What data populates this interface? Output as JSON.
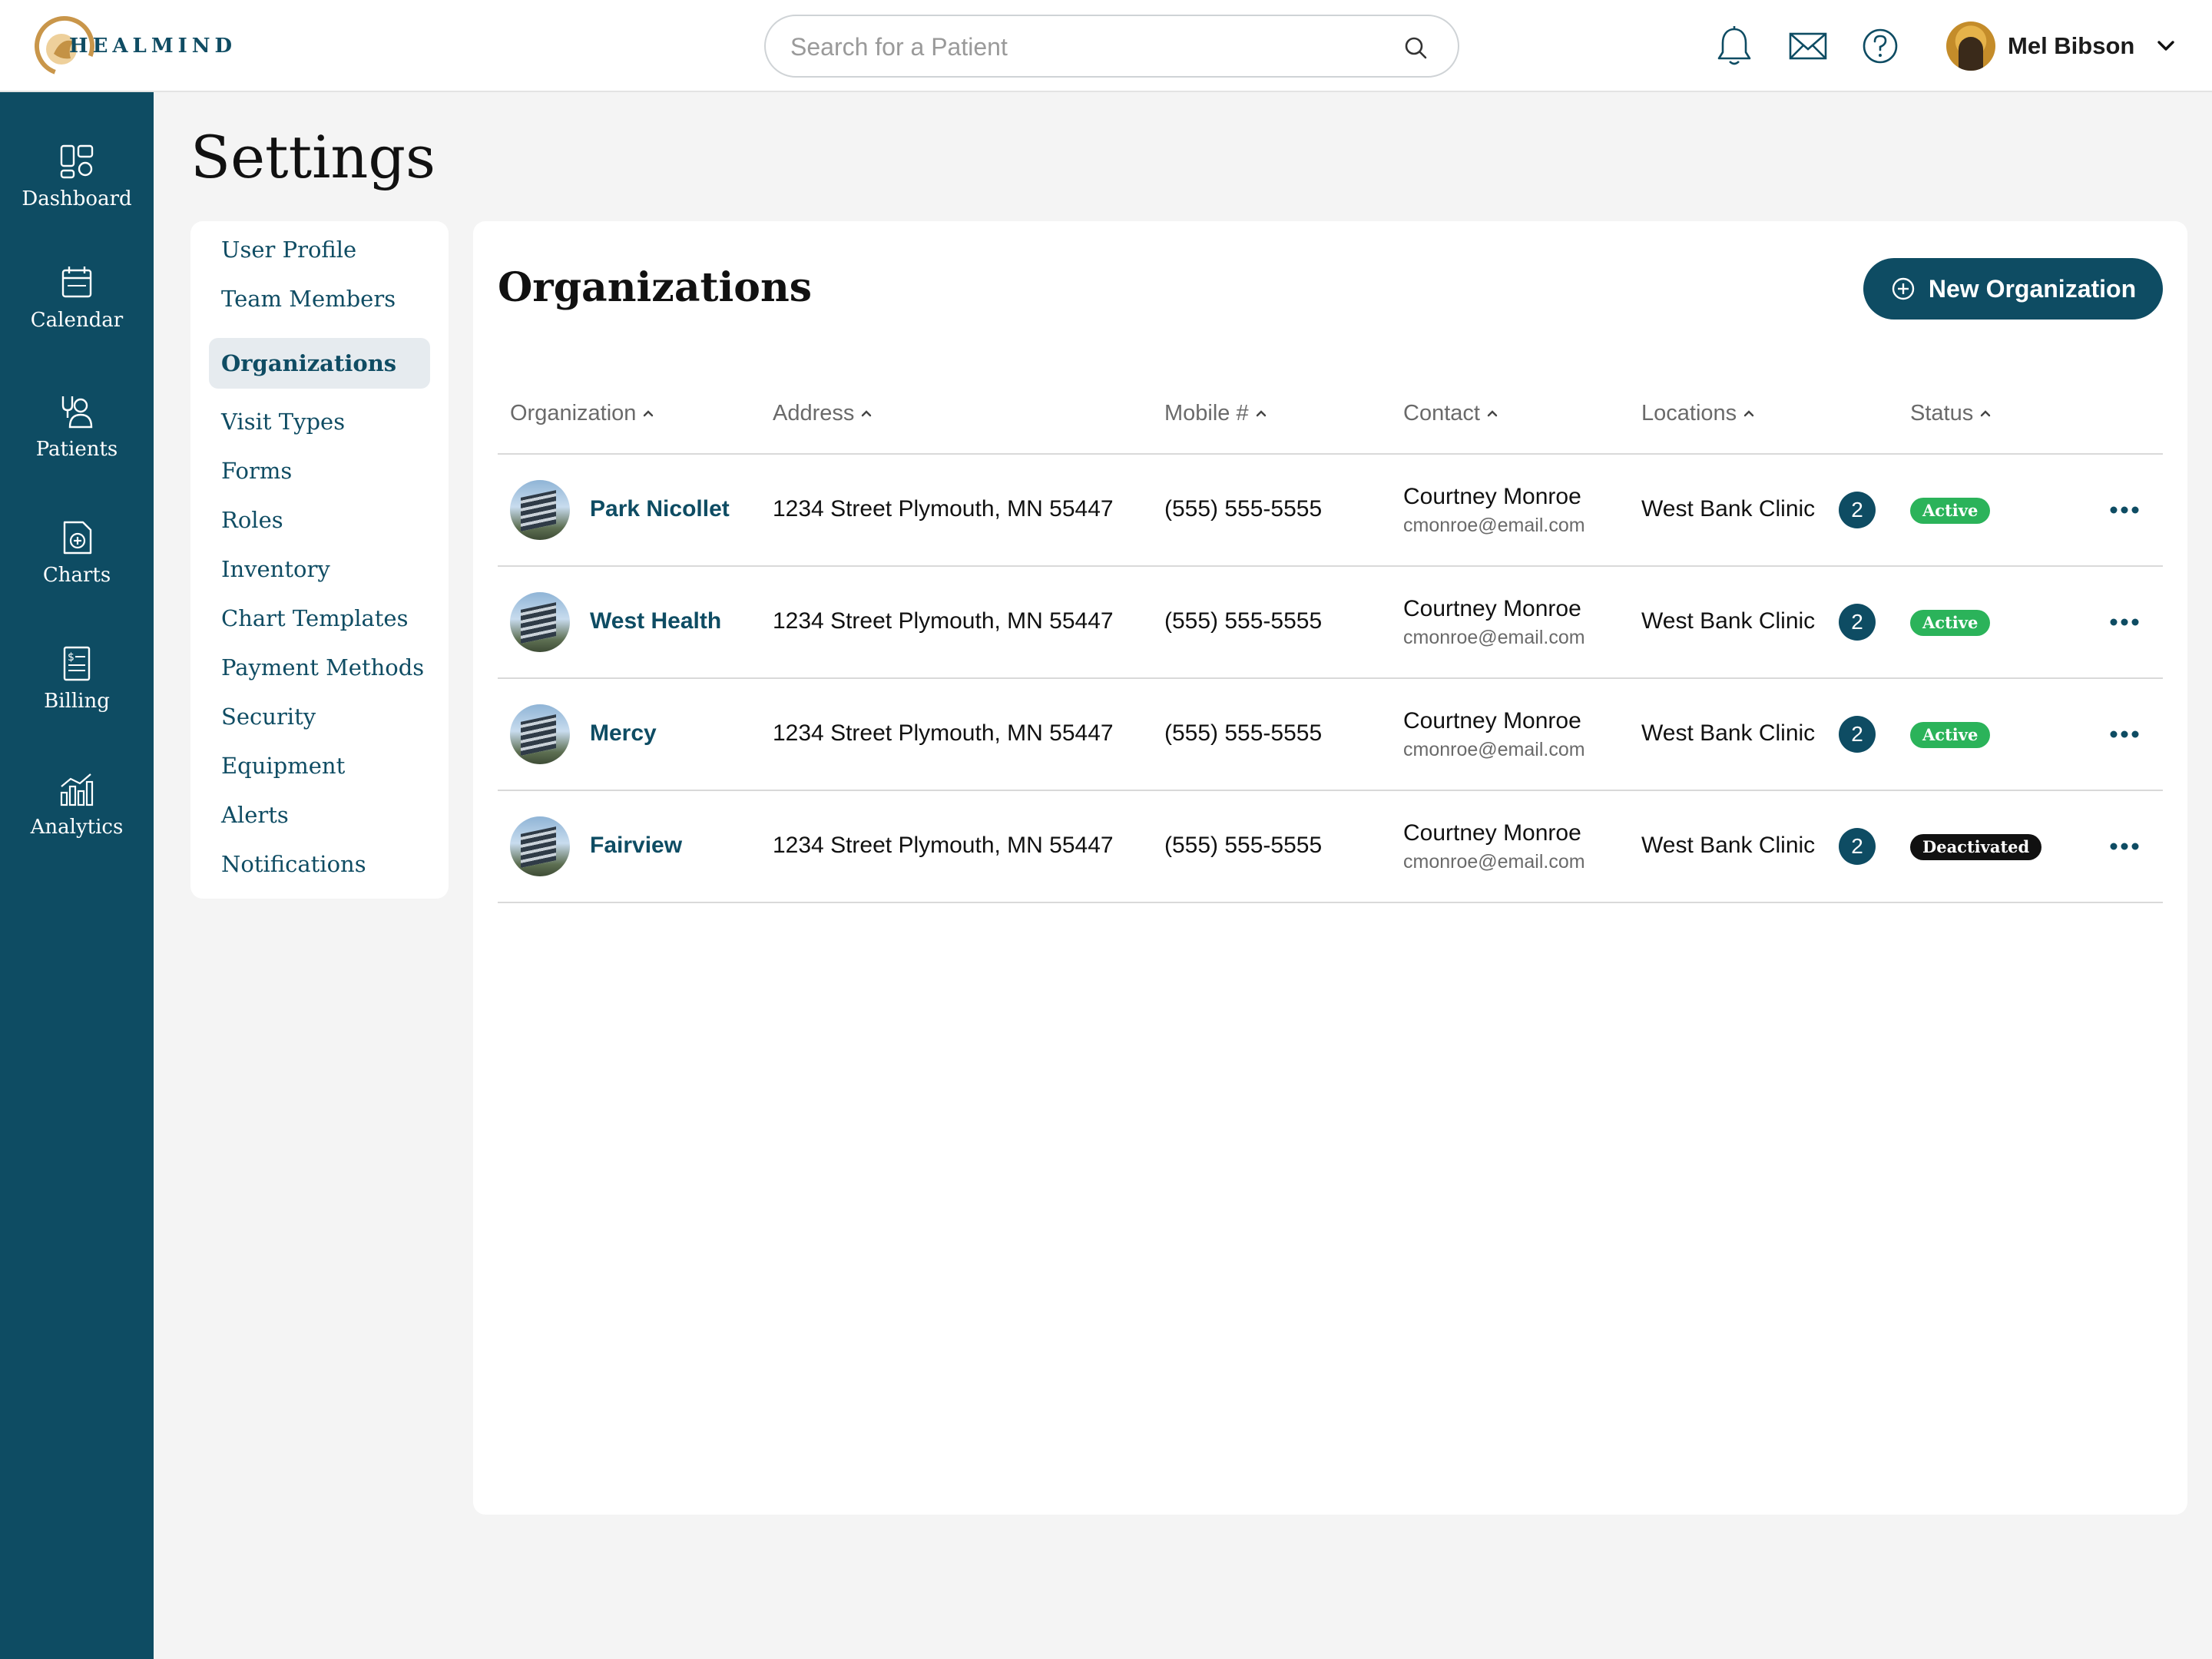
{
  "app": {
    "logo_text": "HEALMIND",
    "search_placeholder": "Search for a Patient",
    "user_name": "Mel Bibson",
    "colors": {
      "primary": "#0e4c63",
      "active": "#2bb35a",
      "deactivated": "#111111",
      "logo_gold": "#c9964a"
    }
  },
  "sidebar": {
    "items": [
      {
        "label": "Dashboard",
        "icon": "dashboard-icon"
      },
      {
        "label": "Calendar",
        "icon": "calendar-icon"
      },
      {
        "label": "Patients",
        "icon": "patients-icon"
      },
      {
        "label": "Charts",
        "icon": "charts-icon"
      },
      {
        "label": "Billing",
        "icon": "billing-icon"
      },
      {
        "label": "Analytics",
        "icon": "analytics-icon"
      }
    ]
  },
  "page": {
    "title": "Settings"
  },
  "settings_menu": {
    "active": "Organizations",
    "items": [
      "User Profile",
      "Team Members",
      "Organizations",
      "Visit Types",
      "Forms",
      "Roles",
      "Inventory",
      "Chart Templates",
      "Payment Methods",
      "Security",
      "Equipment",
      "Alerts",
      "Notifications"
    ]
  },
  "organizations": {
    "title": "Organizations",
    "new_button": "New Organization",
    "columns": [
      "Organization",
      "Address",
      "Mobile #",
      "Contact",
      "Locations",
      "Status"
    ],
    "rows": [
      {
        "name": "Park Nicollet",
        "address": "1234 Street Plymouth, MN 55447",
        "mobile": "(555) 555-5555",
        "contact_name": "Courtney Monroe",
        "contact_email": "cmonroe@email.com",
        "location": "West Bank Clinic",
        "location_count": "2",
        "status": "Active"
      },
      {
        "name": "West Health",
        "address": "1234 Street Plymouth, MN 55447",
        "mobile": "(555) 555-5555",
        "contact_name": "Courtney Monroe",
        "contact_email": "cmonroe@email.com",
        "location": "West Bank Clinic",
        "location_count": "2",
        "status": "Active"
      },
      {
        "name": "Mercy",
        "address": "1234 Street Plymouth, MN 55447",
        "mobile": "(555) 555-5555",
        "contact_name": "Courtney Monroe",
        "contact_email": "cmonroe@email.com",
        "location": "West Bank Clinic",
        "location_count": "2",
        "status": "Active"
      },
      {
        "name": "Fairview",
        "address": "1234 Street Plymouth, MN 55447",
        "mobile": "(555) 555-5555",
        "contact_name": "Courtney Monroe",
        "contact_email": "cmonroe@email.com",
        "location": "West Bank Clinic",
        "location_count": "2",
        "status": "Deactivated"
      }
    ]
  }
}
